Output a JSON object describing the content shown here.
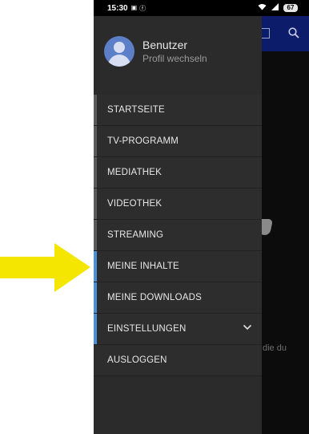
{
  "status": {
    "time": "15:30",
    "battery": "67"
  },
  "profile": {
    "name": "Benutzer",
    "subtitle": "Profil wechseln"
  },
  "menu": [
    {
      "label": "STARTSEITE"
    },
    {
      "label": "TV-PROGRAMM"
    },
    {
      "label": "MEDIATHEK"
    },
    {
      "label": "VIDEOTHEK"
    },
    {
      "label": "STREAMING"
    },
    {
      "label": "MEINE INHALTE"
    },
    {
      "label": "MEINE DOWNLOADS"
    },
    {
      "label": "EINSTELLUNGEN"
    },
    {
      "label": "AUSLOGGEN"
    }
  ],
  "background": {
    "partial_text": "die du"
  },
  "colors": {
    "accent": "#4a90d9",
    "drawer": "#2b2b2b",
    "appbar": "#0d1b6b",
    "annotation_arrow": "#f5e600"
  }
}
